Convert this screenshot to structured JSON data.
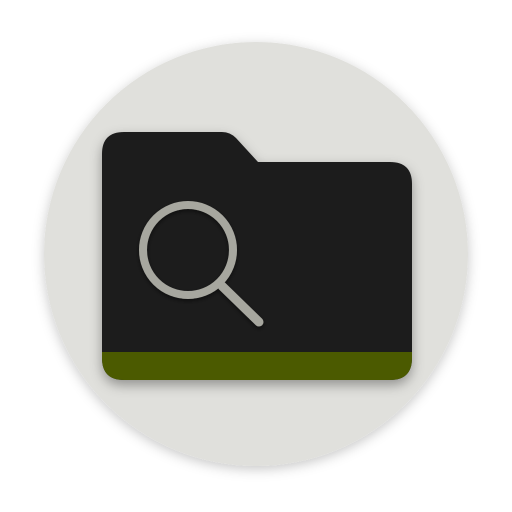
{
  "icon": {
    "name": "folder-search-icon",
    "glyph": "magnifying-glass-icon",
    "colors": {
      "background_circle": "#e0e0dc",
      "folder_body": "#1e1e1e",
      "folder_band": "#4b5a05",
      "glyph": "#a7a79f",
      "page": "#ffffff"
    }
  }
}
